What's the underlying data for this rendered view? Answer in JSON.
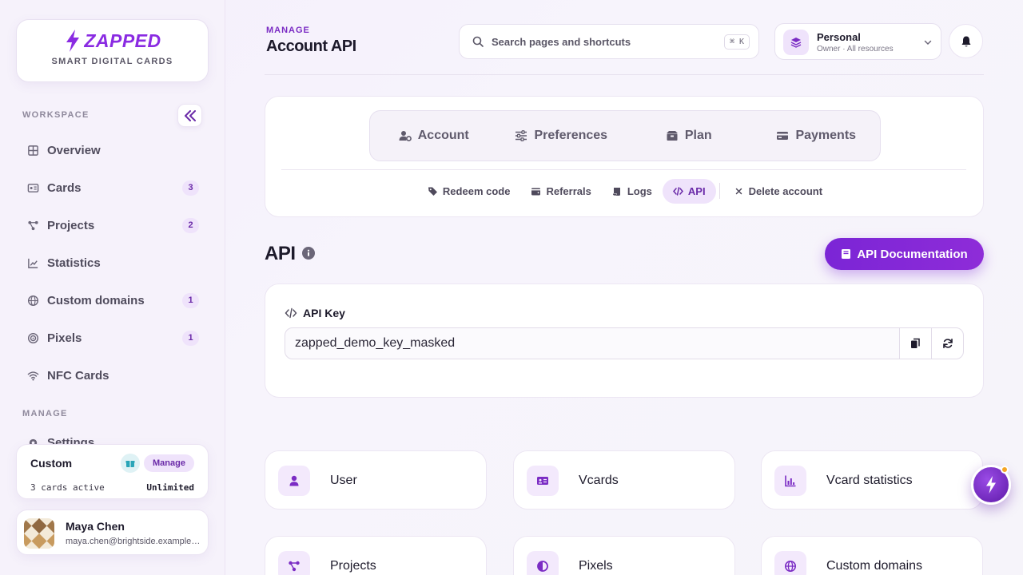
{
  "brand": {
    "name": "ZAPPED",
    "tagline": "SMART DIGITAL CARDS",
    "color": "#8a2be2"
  },
  "sidebar": {
    "workspace_label": "WORKSPACE",
    "manage_label": "MANAGE",
    "items": [
      {
        "label": "Overview",
        "icon": "grid-icon",
        "badge": ""
      },
      {
        "label": "Cards",
        "icon": "id-card-icon",
        "badge": "3"
      },
      {
        "label": "Projects",
        "icon": "nodes-icon",
        "badge": "2"
      },
      {
        "label": "Statistics",
        "icon": "chart-line-icon",
        "badge": ""
      },
      {
        "label": "Custom domains",
        "icon": "globe-icon",
        "badge": "1"
      },
      {
        "label": "Pixels",
        "icon": "target-icon",
        "badge": "1"
      },
      {
        "label": "NFC Cards",
        "icon": "wifi-icon",
        "badge": ""
      }
    ],
    "manage_items": [
      {
        "label": "Settings",
        "icon": "gear-icon"
      }
    ]
  },
  "plan": {
    "name": "Custom",
    "manage_label": "Manage",
    "active": "3 cards active",
    "limit": "Unlimited"
  },
  "user": {
    "name": "Maya Chen",
    "email": "maya.chen@brightside.example.com"
  },
  "header": {
    "kicker": "MANAGE",
    "title": "Account API",
    "search_placeholder": "Search pages and shortcuts",
    "search_shortcut": "⌘ K",
    "workspace_name": "Personal",
    "workspace_sub": "Owner · All resources"
  },
  "tabs": [
    {
      "label": "Account",
      "icon": "user-gear-icon"
    },
    {
      "label": "Preferences",
      "icon": "sliders-icon"
    },
    {
      "label": "Plan",
      "icon": "box-icon"
    },
    {
      "label": "Payments",
      "icon": "credit-card-icon"
    }
  ],
  "subtabs": [
    {
      "label": "Redeem code",
      "icon": "tags-icon",
      "active": false
    },
    {
      "label": "Referrals",
      "icon": "wallet-icon",
      "active": false
    },
    {
      "label": "Logs",
      "icon": "scroll-icon",
      "active": false
    },
    {
      "label": "API",
      "icon": "code-icon",
      "active": true
    },
    {
      "label": "Delete account",
      "icon": "close-icon",
      "active": false
    }
  ],
  "api": {
    "title": "API",
    "docs_label": "API Documentation",
    "key_label": "API Key",
    "key_value": "zapped_demo_key_masked"
  },
  "resources": [
    {
      "label": "User",
      "icon": "user-icon"
    },
    {
      "label": "Vcards",
      "icon": "id-card-icon"
    },
    {
      "label": "Vcard statistics",
      "icon": "bar-chart-icon"
    },
    {
      "label": "Projects",
      "icon": "nodes-icon"
    },
    {
      "label": "Pixels",
      "icon": "half-circle-icon"
    },
    {
      "label": "Custom domains",
      "icon": "globe-icon"
    }
  ]
}
